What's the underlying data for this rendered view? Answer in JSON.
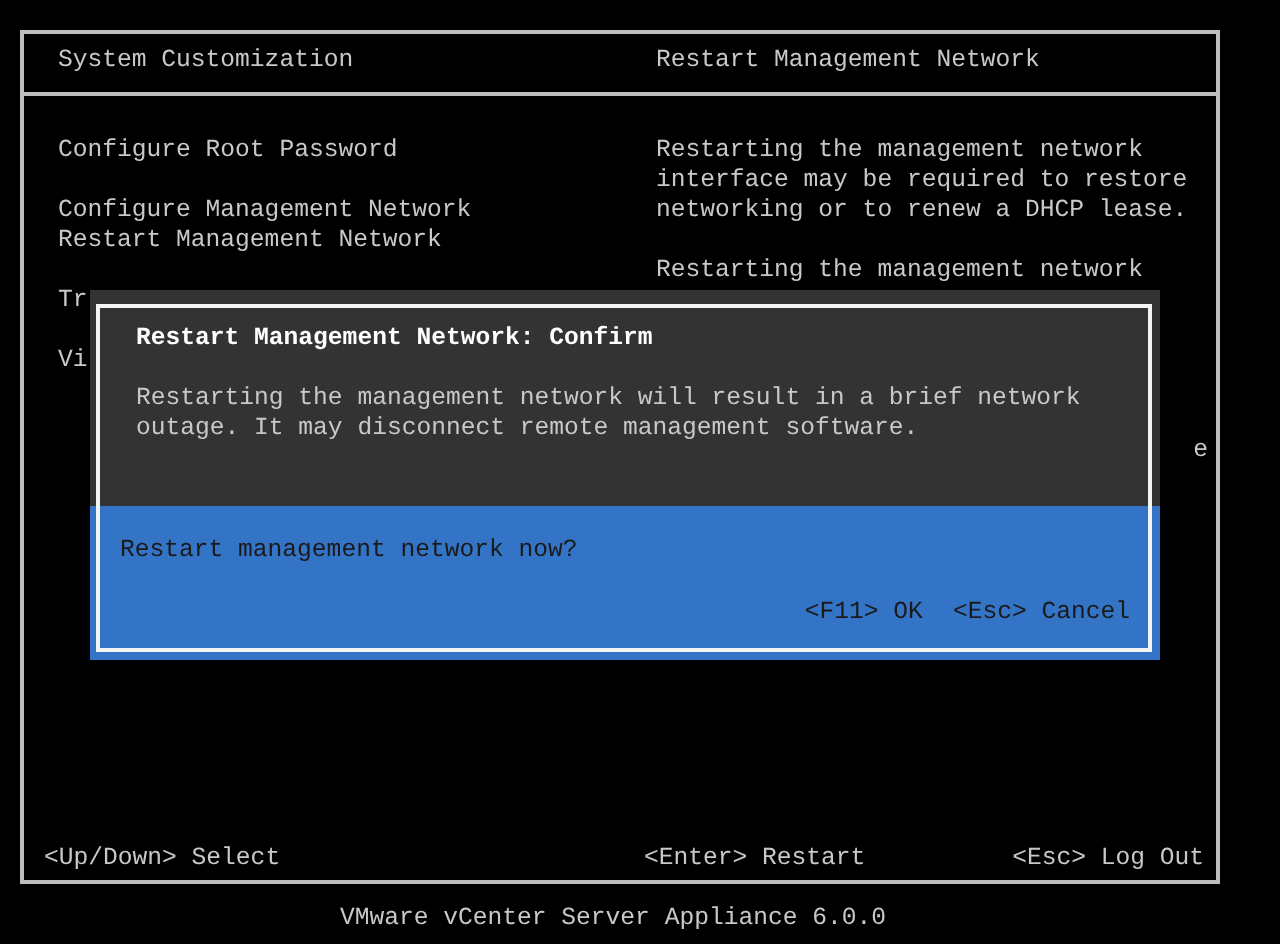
{
  "header": {
    "title": "System Customization",
    "panel_title": "Restart Management Network"
  },
  "menu_groups": [
    {
      "items": [
        "Configure Root Password"
      ]
    },
    {
      "items": [
        "Configure Management Network",
        "Restart Management Network"
      ]
    },
    {
      "items": [
        "Tr"
      ]
    },
    {
      "items": [
        "Vi"
      ]
    }
  ],
  "description": {
    "paragraphs": [
      [
        "Restarting the management network",
        "interface may be required to restore",
        "networking or to renew a DHCP lease."
      ],
      [
        "Restarting the management network"
      ]
    ],
    "fragment": "e"
  },
  "dialog": {
    "title": "Restart Management Network: Confirm",
    "message": [
      "Restarting the management network will result in a brief network",
      "outage. It may disconnect remote management software."
    ],
    "question": "Restart management network now?",
    "buttons": [
      "<F11> OK",
      "<Esc> Cancel"
    ]
  },
  "footer": [
    "<Up/Down> Select",
    "<Enter> Restart",
    "<Esc> Log Out"
  ],
  "product": "VMware vCenter Server Appliance 6.0.0"
}
